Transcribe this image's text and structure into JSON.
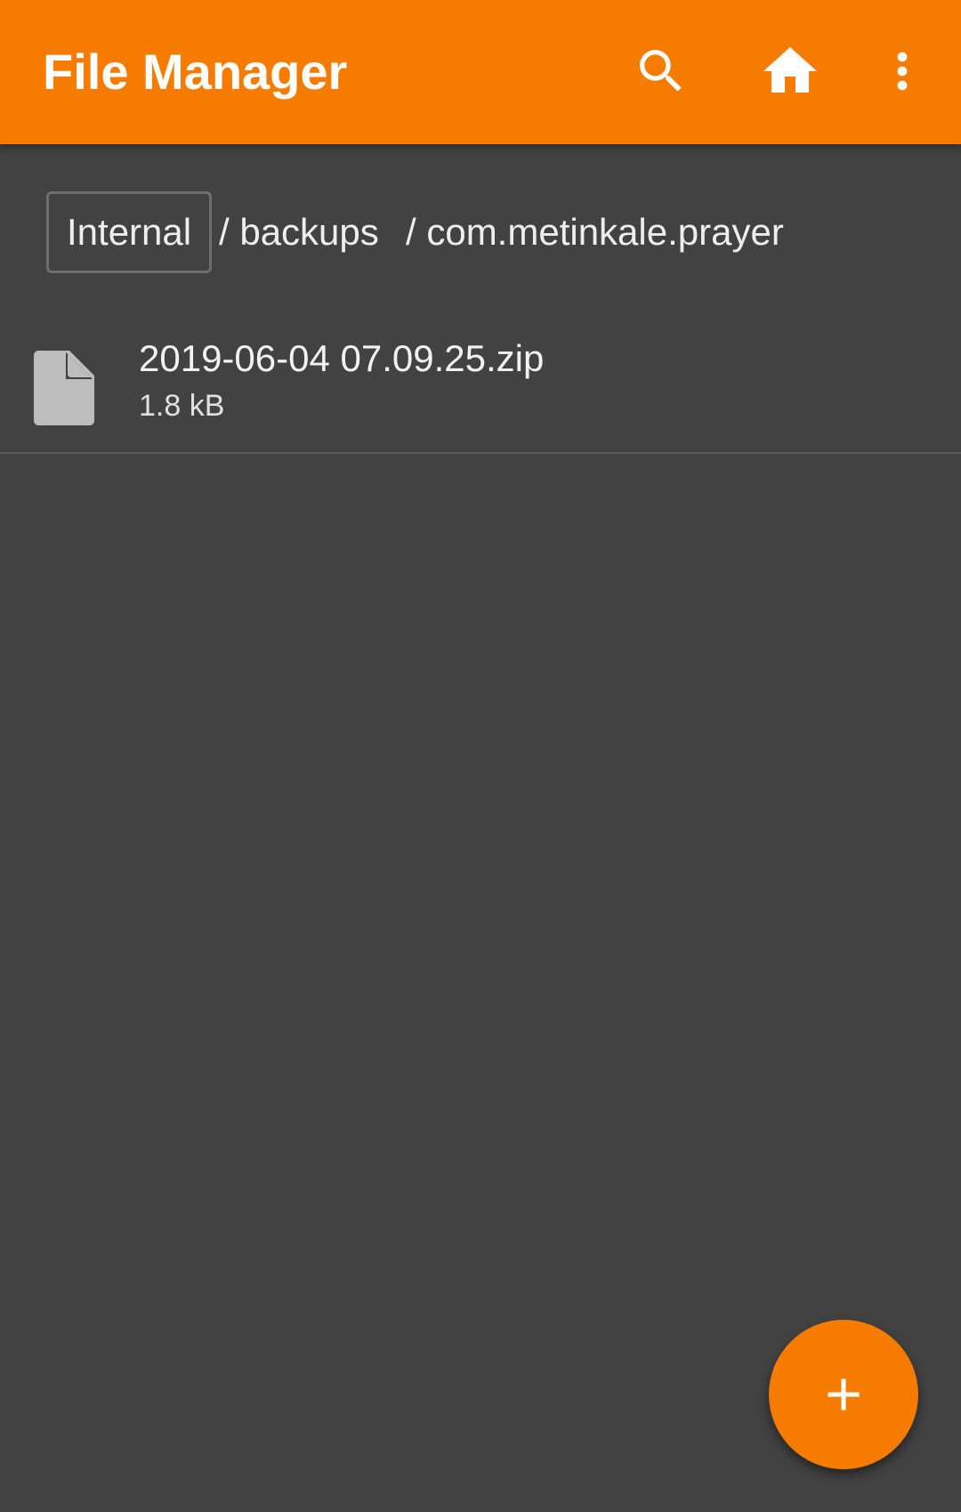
{
  "app_bar": {
    "title": "File Manager",
    "background_color": "#f57c00",
    "actions": [
      {
        "icon": "search-icon"
      },
      {
        "icon": "home-icon"
      },
      {
        "icon": "more-vert-icon"
      }
    ]
  },
  "breadcrumb": {
    "root": "Internal",
    "segments": [
      "/ backups",
      "/ com.metinkale.prayer"
    ]
  },
  "files": [
    {
      "icon": "file-icon",
      "name": "2019-06-04 07.09.25.zip",
      "size": "1.8 kB"
    }
  ],
  "fab": {
    "icon": "plus-icon",
    "color": "#f57c00"
  },
  "background_color": "#424242"
}
